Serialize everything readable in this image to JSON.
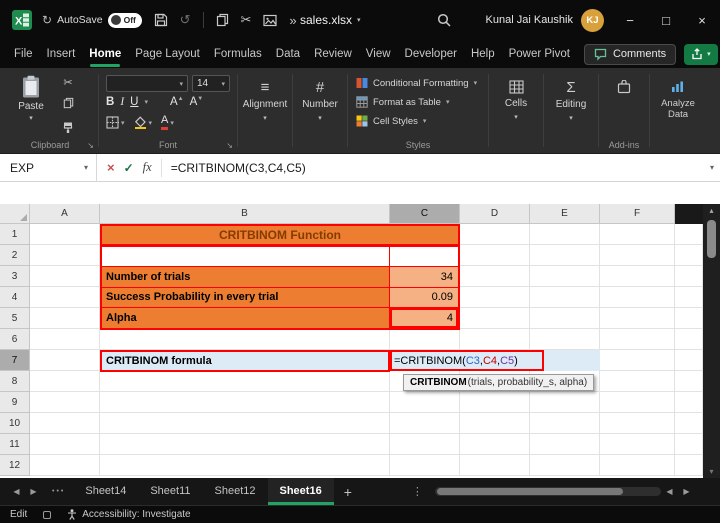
{
  "titlebar": {
    "autosave_label": "AutoSave",
    "autosave_state": "Off",
    "filename": "sales.xlsx",
    "user_name": "Kunal Jai Kaushik",
    "user_initials": "KJ"
  },
  "menubar": {
    "tabs": [
      "File",
      "Insert",
      "Home",
      "Page Layout",
      "Formulas",
      "Data",
      "Review",
      "View",
      "Developer",
      "Help",
      "Power Pivot"
    ],
    "active_tab": "Home",
    "comments_label": "Comments"
  },
  "ribbon": {
    "paste_label": "Paste",
    "clipboard_group_label": "Clipboard",
    "font_name_value": "",
    "font_size_value": "14",
    "bold_label": "B",
    "italic_label": "I",
    "underline_label": "U",
    "font_group_label": "Font",
    "alignment_label": "Alignment",
    "number_label": "Number",
    "conditional_formatting_label": "Conditional Formatting",
    "format_as_table_label": "Format as Table",
    "cell_styles_label": "Cell Styles",
    "styles_group_label": "Styles",
    "cells_label": "Cells",
    "editing_label": "Editing",
    "addins_label": "Add-ins",
    "analyze_data_label": "Analyze Data"
  },
  "formula_bar": {
    "name_box_value": "EXP",
    "fx_label": "fx",
    "formula": "=CRITBINOM(C3,C4,C5)"
  },
  "grid": {
    "col_headers": [
      "A",
      "B",
      "C",
      "D",
      "E",
      "F"
    ],
    "row_headers": [
      "1",
      "2",
      "3",
      "4",
      "5",
      "6",
      "7",
      "8",
      "9",
      "10",
      "11",
      "12"
    ],
    "selected_col": "C",
    "selected_row": "7",
    "title_cell": "CRITBINOM Function",
    "rows": [
      {
        "label": "Number of trials",
        "value": "34"
      },
      {
        "label": "Success Probability in every trial",
        "value": "0.09"
      },
      {
        "label": "Alpha",
        "value": "4"
      }
    ],
    "formula_row_label": "CRITBINOM formula",
    "formula_parts": {
      "prefix": "=CRITBINOM(",
      "ref1": "C3",
      "sep1": ",",
      "ref2": "C4",
      "sep2": ",",
      "ref3": "C5",
      "suffix": ")"
    },
    "tooltip": {
      "function_name": "CRITBINOM",
      "signature": "(trials, probability_s, alpha)"
    }
  },
  "sheet_bar": {
    "tabs": [
      "Sheet14",
      "Sheet11",
      "Sheet12",
      "Sheet16"
    ],
    "active_tab": "Sheet16",
    "add_sheet_label": "+"
  },
  "status_bar": {
    "mode": "Edit",
    "accessibility": "Accessibility: Investigate"
  },
  "colors": {
    "accent_green": "#21A366",
    "orange_fill": "#ED7D31",
    "orange_light_fill": "#F5B183",
    "title_text": "#833C00",
    "blue_fill": "#DDEBF7",
    "highlight_red": "#FF0000",
    "ref1_blue": "#2B64C5",
    "ref2_red": "#C00000",
    "ref3_purple": "#7030A0",
    "avatar_bg": "#D9A13B"
  }
}
